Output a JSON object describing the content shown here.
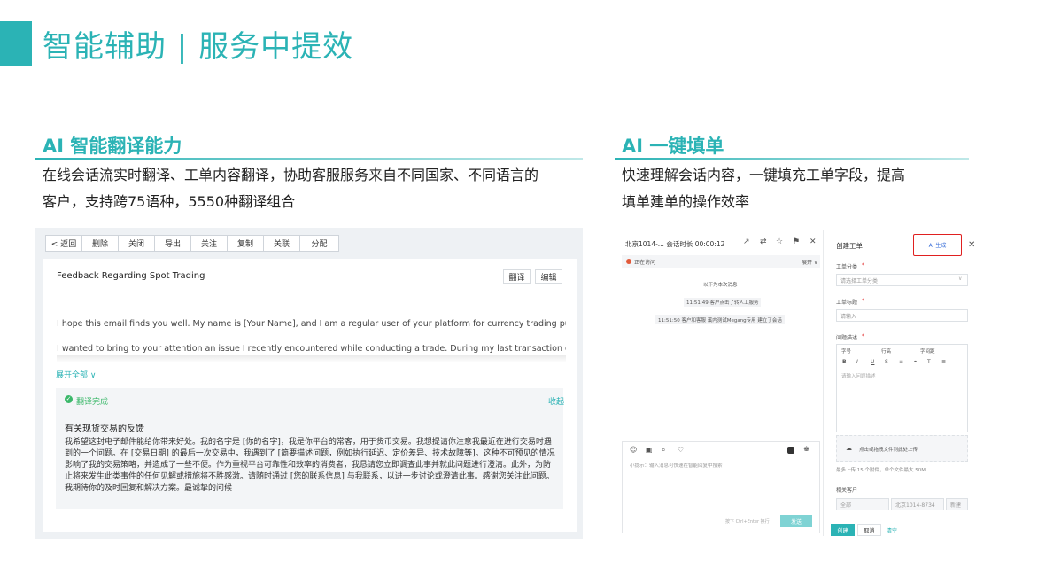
{
  "page": {
    "title": "智能辅助 | 服务中提效",
    "accent_color": "#2bb3b5"
  },
  "section_left": {
    "title": "AI 智能翻译能力",
    "desc_line1": "在线会话流实时翻译、工单内容翻译，协助客服服务来自不同国家、不同语言的",
    "desc_line2": "客户，支持跨75语种，5550种翻译组合"
  },
  "section_right": {
    "title": "AI 一键填单",
    "desc_line1": "快速理解会话内容，一键填充工单字段，提高",
    "desc_line2": "填单建单的操作效率"
  },
  "ticket_toolbar": {
    "back": "< 返回",
    "buttons": [
      "删除",
      "关闭",
      "导出",
      "关注",
      "复制",
      "关联",
      "分配"
    ]
  },
  "email": {
    "subject": "Feedback Regarding Spot Trading",
    "translate_btn": "翻译",
    "edit_btn": "编辑",
    "para1": "I hope this email finds you well. My name is [Your Name], and I am a regular user of your platform for currency trading purposes.",
    "para2": "I wanted to bring to your attention an issue I recently encountered while conducting a trade. During my last transaction on [Date",
    "expand_all": "展开全部 ∨",
    "translation_status": "翻译完成",
    "collapse": "收起",
    "zh_title": "有关现货交易的反馈",
    "zh_body": "我希望这封电子邮件能给你带来好处。我的名字是 [你的名字]，我是你平台的常客，用于货币交易。我想提请你注意我最近在进行交易时遇到的一个问题。在 [交易日期] 的最后一次交易中，我遇到了 [简要描述问题，例如执行延迟、定价差异、技术故障等]。这种不可预见的情况影响了我的交易策略，并造成了一些不便。作为重视平台可靠性和效率的消费者，我恳请您立即调查此事并就此问题进行澄清。此外，为防止将来发生此类事件的任何见解或措施将不胜感激。请随时通过 [您的联系信息] 与我联系，以进一步讨论或澄清此事。感谢您关注此问题。我期待你的及时回复和解决方案。最诚挚的问候"
  },
  "chat": {
    "header": "北京1014-... 会话时长 00:00:12",
    "status": "正在访问",
    "expand": "展开 ∨",
    "divider": "以下为本次消息",
    "event1": "11:51:49 客户点击了转人工服务",
    "event2": "11:51:50 客户和客服 溪内测试Megang专用 建立了会话",
    "input_hint": "小提示：输入消息可快速在智能回复中搜索",
    "send_hint": "按下 Ctrl+Enter 换行",
    "send": "发送"
  },
  "ticket_form": {
    "title": "创建工单",
    "ai_button": "AI 生成",
    "category_label": "工单分类",
    "category_placeholder": "请选择工单分类",
    "title_label": "工单标题",
    "title_placeholder": "请输入",
    "desc_label": "问题描述",
    "editor_font": "字号",
    "editor_line": "行高",
    "editor_spacing": "字间距",
    "desc_placeholder": "请输入问题描述",
    "upload_text": "点击或拖拽文件到此处上传",
    "upload_hint": "最多上传 15 个附件，单个文件最大 50M",
    "customer_label": "相关客户",
    "customer_scope": "全部",
    "customer_value": "北京1014-8734",
    "customer_btn": "新建",
    "create_btn": "创建",
    "cancel_btn": "取消",
    "clear_btn": "清空"
  }
}
